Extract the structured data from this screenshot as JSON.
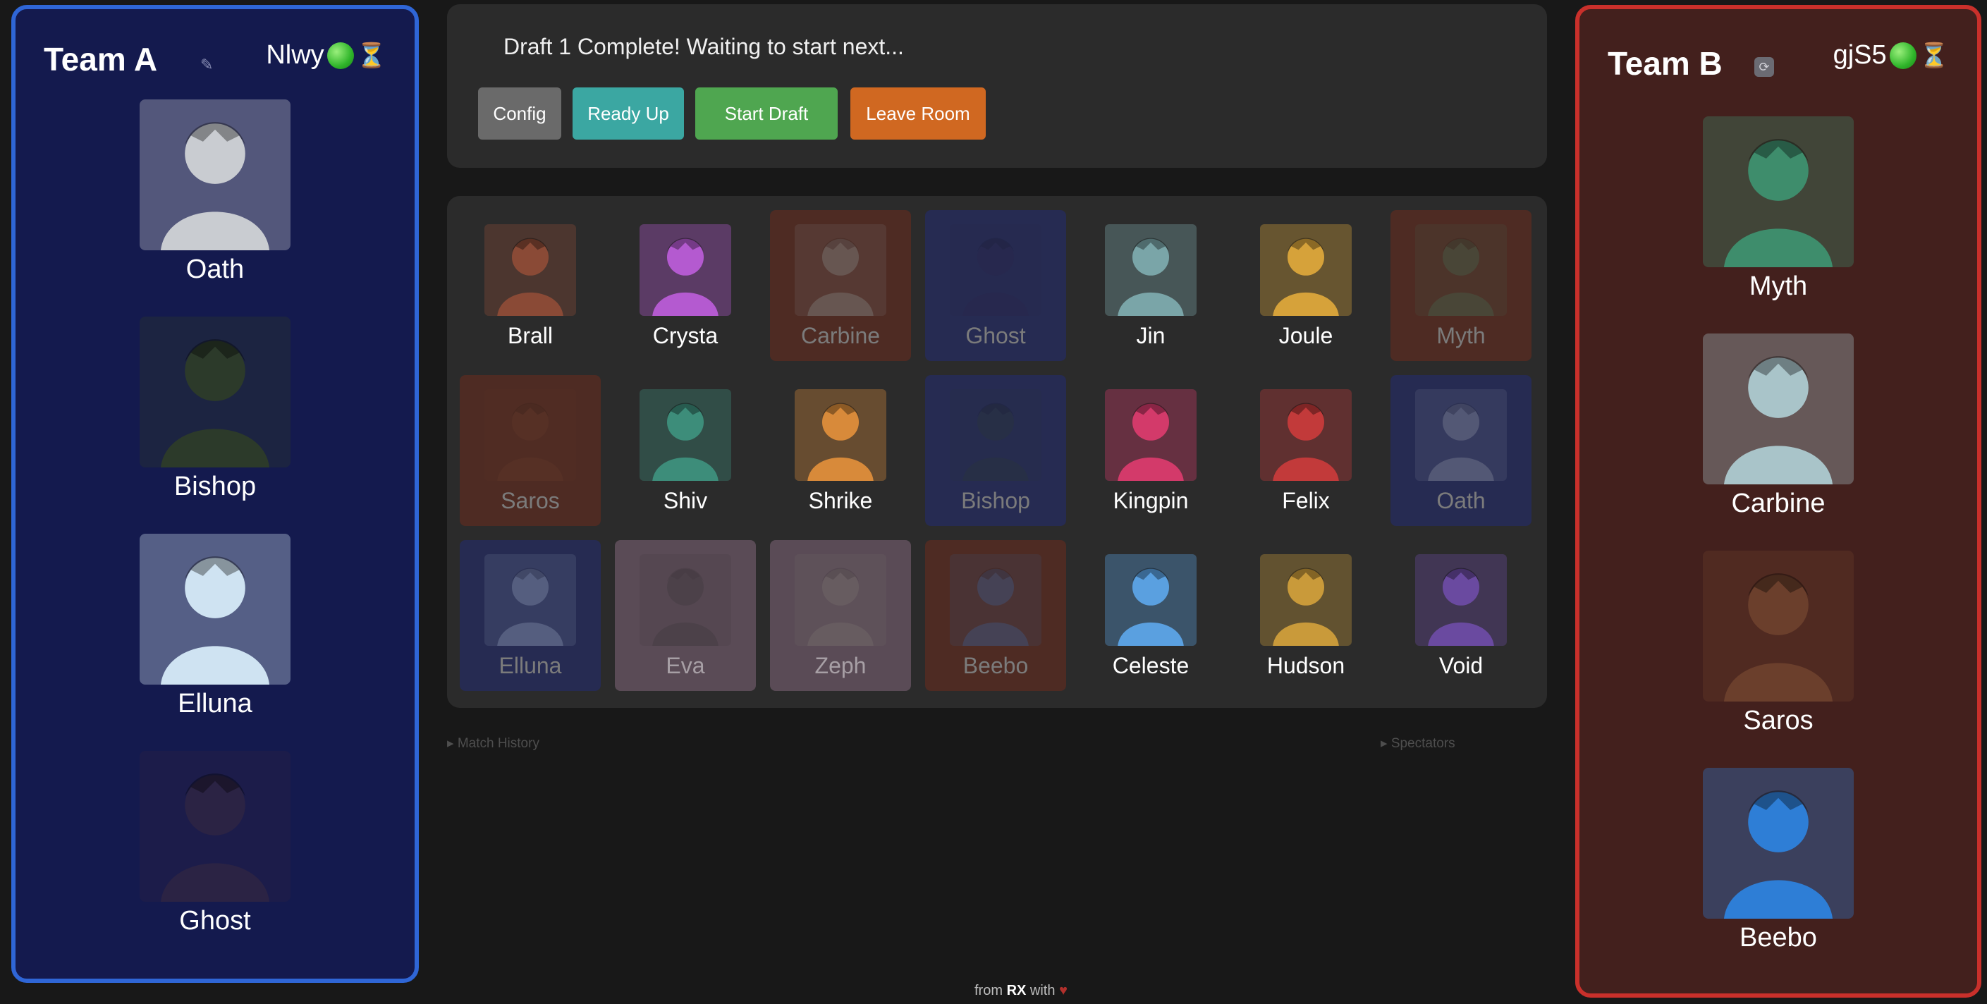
{
  "team_a": {
    "name": "Team A",
    "edit_icon": "pencil-icon",
    "user": "Nlwy",
    "status_icon": "green-dot-icon",
    "timer_icon": "hourglass-icon",
    "accent": "#2f66d6",
    "picks": [
      {
        "name": "Oath",
        "color": "#c9ccd1"
      },
      {
        "name": "Bishop",
        "color": "#2c3a2a"
      },
      {
        "name": "Elluna",
        "color": "#cfe3f2"
      },
      {
        "name": "Ghost",
        "color": "#2b2344"
      }
    ]
  },
  "team_b": {
    "name": "Team B",
    "edit_icon": "swap-icon",
    "user": "gjS5",
    "status_icon": "green-dot-icon",
    "timer_icon": "hourglass-icon",
    "accent": "#c9302b",
    "picks": [
      {
        "name": "Myth",
        "color": "#3e8d6c"
      },
      {
        "name": "Carbine",
        "color": "#a9c4c9"
      },
      {
        "name": "Saros",
        "color": "#6b3f2c"
      },
      {
        "name": "Beebo",
        "color": "#2e7ed6"
      }
    ]
  },
  "header": {
    "status": "Draft 1 Complete! Waiting to start next...",
    "buttons": {
      "config": "Config",
      "ready": "Ready Up",
      "start": "Start Draft",
      "leave": "Leave Room"
    }
  },
  "heroes": [
    {
      "name": "Brall",
      "state": "available",
      "color": "#8a4a36"
    },
    {
      "name": "Crysta",
      "state": "available",
      "color": "#b45ad0"
    },
    {
      "name": "Carbine",
      "state": "picked-b",
      "color": "#a9c4c9"
    },
    {
      "name": "Ghost",
      "state": "picked-a",
      "color": "#2b2344"
    },
    {
      "name": "Jin",
      "state": "available",
      "color": "#7aa5a8"
    },
    {
      "name": "Joule",
      "state": "available",
      "color": "#d6a23a"
    },
    {
      "name": "Myth",
      "state": "picked-b",
      "color": "#3e8d6c"
    },
    {
      "name": "Saros",
      "state": "picked-b",
      "color": "#6b3f2c"
    },
    {
      "name": "Shiv",
      "state": "available",
      "color": "#3d8d7a"
    },
    {
      "name": "Shrike",
      "state": "available",
      "color": "#d88a3a"
    },
    {
      "name": "Bishop",
      "state": "picked-a",
      "color": "#2c3a2a"
    },
    {
      "name": "Kingpin",
      "state": "available",
      "color": "#d33a6a"
    },
    {
      "name": "Felix",
      "state": "available",
      "color": "#c23a3a"
    },
    {
      "name": "Oath",
      "state": "picked-a",
      "color": "#c9ccd1"
    },
    {
      "name": "Elluna",
      "state": "picked-a",
      "color": "#cfe3f2"
    },
    {
      "name": "Eva",
      "state": "banned",
      "color": "#2a2a2a"
    },
    {
      "name": "Zeph",
      "state": "banned",
      "color": "#8a8a7a"
    },
    {
      "name": "Beebo",
      "state": "picked-b",
      "color": "#2e7ed6"
    },
    {
      "name": "Celeste",
      "state": "available",
      "color": "#5aa0e0"
    },
    {
      "name": "Hudson",
      "state": "available",
      "color": "#c99a3a"
    },
    {
      "name": "Void",
      "state": "available",
      "color": "#6a4aa0"
    }
  ],
  "collapsibles": {
    "match_history": "▸ Match History",
    "spectators": "▸ Spectators"
  },
  "footer": {
    "prefix": "from",
    "brand": "RX",
    "suffix": "with",
    "heart_icon": "heart-icon"
  }
}
